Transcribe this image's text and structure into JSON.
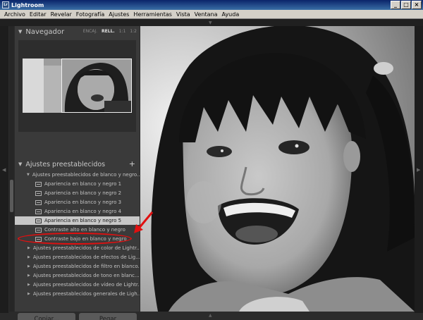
{
  "window": {
    "title": "Lightroom",
    "app_icon": "Lr",
    "buttons": [
      "_",
      "□",
      "×"
    ]
  },
  "menu": [
    "Archivo",
    "Editar",
    "Revelar",
    "Fotografía",
    "Ajustes",
    "Herramientas",
    "Vista",
    "Ventana",
    "Ayuda"
  ],
  "navigator": {
    "title": "Navegador",
    "zoom_options": [
      "ENCAJ.",
      "RELL.",
      "1:1",
      "1:2"
    ],
    "active_zoom": "RELL."
  },
  "presets": {
    "title": "Ajustes preestablecidos",
    "add_symbol": "+",
    "items": [
      {
        "type": "folder",
        "open": true,
        "label": "Ajustes preestablecidos de blanco y negro..."
      },
      {
        "type": "child",
        "label": "Apariencia en blanco y negro 1"
      },
      {
        "type": "child",
        "label": "Apariencia en blanco y negro 2"
      },
      {
        "type": "child",
        "label": "Apariencia en blanco y negro 3"
      },
      {
        "type": "child",
        "label": "Apariencia en blanco y negro 4"
      },
      {
        "type": "child",
        "label": "Apariencia en blanco y negro 5",
        "selected": true
      },
      {
        "type": "child",
        "label": "Contraste alto en blanco y negro"
      },
      {
        "type": "child",
        "label": "Contraste bajo en blanco y negro"
      },
      {
        "type": "folder",
        "label": "Ajustes preestablecidos de color de Lightr..."
      },
      {
        "type": "folder",
        "label": "Ajustes preestablecidos de efectos de Lig..."
      },
      {
        "type": "folder",
        "label": "Ajustes preestablecidos de filtro en blanco..."
      },
      {
        "type": "folder",
        "label": "Ajustes preestablecidos de tono en blanc..."
      },
      {
        "type": "folder",
        "label": "Ajustes preestablecidos de vídeo de Lightr..."
      },
      {
        "type": "folder",
        "label": "Ajustes preestablecidos generales de Ligh..."
      }
    ]
  },
  "buttons": {
    "copy": "Copiar...",
    "paste": "Pegar"
  },
  "annotation": {
    "color": "#e01010"
  }
}
